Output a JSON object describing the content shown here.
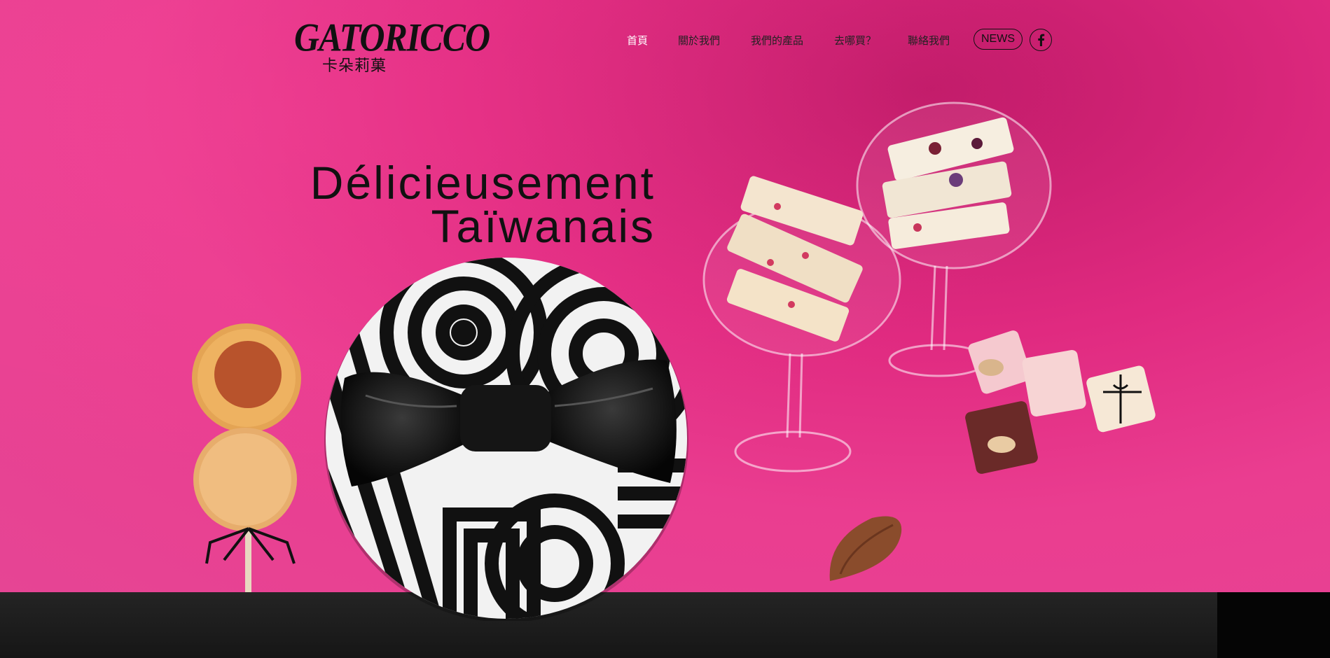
{
  "brand": {
    "logo_text": "GATORICCO",
    "logo_subtitle": "卡朵莉菓"
  },
  "nav": {
    "items": [
      {
        "label": "首頁",
        "active": true
      },
      {
        "label": "關於我們",
        "active": false
      },
      {
        "label": "我們的產品",
        "active": false
      },
      {
        "label": "去哪買？",
        "active": false
      },
      {
        "label": "聯絡我們",
        "active": false
      }
    ],
    "news_label": "NEWS",
    "social_icon": "facebook-icon"
  },
  "hero": {
    "headline_line1": "Délicieusement",
    "headline_line2": "Taïwanais"
  },
  "colors": {
    "hero_pink": "#e02a80",
    "text_dark": "#111111",
    "active_nav": "#ffffff",
    "footer": "#1a1a1a"
  }
}
